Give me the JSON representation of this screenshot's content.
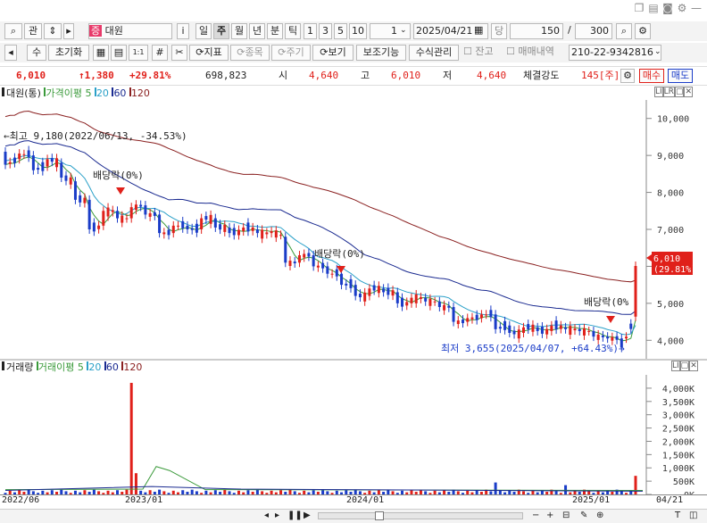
{
  "window": {
    "controls": [
      "□",
      "□",
      "◎",
      "⚙",
      "—"
    ]
  },
  "toolbar1": {
    "search_icon": "⌕",
    "kwan": "관",
    "up_down": "⇕",
    "stock_badge": "증",
    "stock_name": "대원",
    "info": "i",
    "periods": [
      "일",
      "주",
      "월",
      "년",
      "분",
      "틱"
    ],
    "active_period": "주",
    "nums": [
      "1",
      "3",
      "5",
      "10"
    ],
    "count_value": "1",
    "date": "2025/04/21",
    "date_label": "당",
    "view_count": "150",
    "slash": "/",
    "total_count": "300"
  },
  "toolbar2": {
    "su": "수",
    "reset": "초기화",
    "one_one": "1:1",
    "indicator": "지표",
    "item": "종목",
    "period": "주기",
    "view": "보기",
    "aux": "보조기능",
    "formula": "수식관리",
    "balance": "잔고",
    "trade_history": "매매내역",
    "account": "210-22-9342816"
  },
  "quote": {
    "price": "6,010",
    "change": "↑1,380",
    "pct": "+29.81%",
    "volume": "698,823",
    "open_label": "시",
    "open": "4,640",
    "high_label": "고",
    "high": "6,010",
    "low_label": "저",
    "low": "4,640",
    "strength_label": "체결강도",
    "strength": "145[주]",
    "buy": "매수",
    "sell": "매도"
  },
  "price_panel": {
    "title": "대원(통)",
    "ma_label": "가격이평",
    "ma5": "5",
    "ma20": "20",
    "ma60": "60",
    "ma120": "120",
    "max_note": "←최고 9,180(2022/06/13, -34.53%)",
    "min_note": "최저 3,655(2025/04/07, +64.43%)→",
    "div1": "배당락(0%)",
    "div2": "배당락(0%)",
    "div3": "배당락(0%",
    "price_tag": "6,010",
    "price_tag_pct": "(29.81%)"
  },
  "volume_panel": {
    "title": "거래량",
    "ma_label": "거래이평",
    "ma5": "5",
    "ma20": "20",
    "ma60": "60",
    "ma120": "120"
  },
  "colors": {
    "up": "#e0201a",
    "down": "#1a3cc8",
    "ma5": "#3a9a3a",
    "ma20": "#2aa0c8",
    "ma60": "#1a2a90",
    "ma120": "#8a2020"
  },
  "chart_data": {
    "type": "candlestick",
    "price_axis": {
      "ticks": [
        "10,000",
        "9,000",
        "8,000",
        "7,000",
        "6,000",
        "5,000",
        "4,000"
      ],
      "range": [
        3500,
        10500
      ]
    },
    "volume_axis": {
      "ticks": [
        "4,000K",
        "3,500K",
        "3,000K",
        "2,500K",
        "2,000K",
        "1,500K",
        "1,000K",
        "500K",
        "0K"
      ]
    },
    "x_ticks": [
      "2022/06",
      "2023/01",
      "2024/01",
      "2025/01",
      "04/21"
    ],
    "approx_candles": [
      {
        "i": 0,
        "o": 9100,
        "c": 8750
      },
      {
        "i": 3,
        "o": 8900,
        "c": 9050
      },
      {
        "i": 6,
        "o": 9000,
        "c": 8600
      },
      {
        "i": 9,
        "o": 8700,
        "c": 8900
      },
      {
        "i": 12,
        "o": 8800,
        "c": 8400
      },
      {
        "i": 15,
        "o": 8300,
        "c": 7800
      },
      {
        "i": 18,
        "o": 7800,
        "c": 7000
      },
      {
        "i": 21,
        "o": 7100,
        "c": 7500
      },
      {
        "i": 24,
        "o": 7500,
        "c": 7300
      },
      {
        "i": 27,
        "o": 7300,
        "c": 7600
      },
      {
        "i": 30,
        "o": 7650,
        "c": 7400
      },
      {
        "i": 33,
        "o": 7400,
        "c": 6900
      },
      {
        "i": 36,
        "o": 6900,
        "c": 7100
      },
      {
        "i": 39,
        "o": 7100,
        "c": 7000
      },
      {
        "i": 42,
        "o": 7000,
        "c": 7300
      },
      {
        "i": 45,
        "o": 7300,
        "c": 7050
      },
      {
        "i": 48,
        "o": 7050,
        "c": 6900
      },
      {
        "i": 51,
        "o": 6950,
        "c": 7050
      },
      {
        "i": 54,
        "o": 7000,
        "c": 6900
      },
      {
        "i": 57,
        "o": 6900,
        "c": 6950
      },
      {
        "i": 60,
        "o": 6800,
        "c": 6100
      },
      {
        "i": 63,
        "o": 6100,
        "c": 6300
      },
      {
        "i": 66,
        "o": 6300,
        "c": 6000
      },
      {
        "i": 69,
        "o": 6000,
        "c": 5800
      },
      {
        "i": 72,
        "o": 5800,
        "c": 5500
      },
      {
        "i": 75,
        "o": 5500,
        "c": 5200
      },
      {
        "i": 78,
        "o": 5200,
        "c": 5400
      },
      {
        "i": 81,
        "o": 5400,
        "c": 5300
      },
      {
        "i": 84,
        "o": 5300,
        "c": 5000
      },
      {
        "i": 87,
        "o": 5000,
        "c": 5150
      },
      {
        "i": 90,
        "o": 5150,
        "c": 5050
      },
      {
        "i": 93,
        "o": 5050,
        "c": 4900
      },
      {
        "i": 96,
        "o": 4900,
        "c": 4500
      },
      {
        "i": 99,
        "o": 4500,
        "c": 4600
      },
      {
        "i": 102,
        "o": 4600,
        "c": 4700
      },
      {
        "i": 105,
        "o": 4700,
        "c": 4300
      },
      {
        "i": 108,
        "o": 4400,
        "c": 4200
      },
      {
        "i": 111,
        "o": 4200,
        "c": 4350
      },
      {
        "i": 114,
        "o": 4350,
        "c": 4250
      },
      {
        "i": 117,
        "o": 4250,
        "c": 4400
      },
      {
        "i": 120,
        "o": 4350,
        "c": 4300
      },
      {
        "i": 123,
        "o": 4300,
        "c": 4250
      },
      {
        "i": 126,
        "o": 4250,
        "c": 4100
      },
      {
        "i": 129,
        "o": 4100,
        "c": 4050
      },
      {
        "i": 132,
        "o": 4050,
        "c": 3800
      },
      {
        "i": 135,
        "o": 4640,
        "c": 6010
      }
    ]
  }
}
